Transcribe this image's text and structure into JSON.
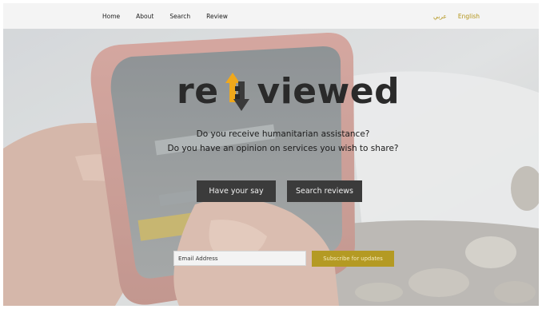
{
  "nav": {
    "items": [
      {
        "label": "Home"
      },
      {
        "label": "About"
      },
      {
        "label": "Search"
      },
      {
        "label": "Review"
      }
    ]
  },
  "language": {
    "arabic": "عربي",
    "english": "English"
  },
  "logo": {
    "left_text": "re",
    "right_text": "viewed",
    "arrow_up_color": "#f0a81b",
    "arrow_down_color": "#3a3a3a"
  },
  "tagline": {
    "line1": "Do you receive humanitarian assistance?",
    "line2": "Do you have an opinion on services you wish to share?"
  },
  "buttons": {
    "have_your_say": "Have your say",
    "search_reviews": "Search reviews"
  },
  "subscribe": {
    "email_placeholder": "Email Address",
    "button_label": "Subscribe for updates"
  },
  "colors": {
    "accent_gold": "#b49a23",
    "button_dark": "#3b3b3b"
  }
}
